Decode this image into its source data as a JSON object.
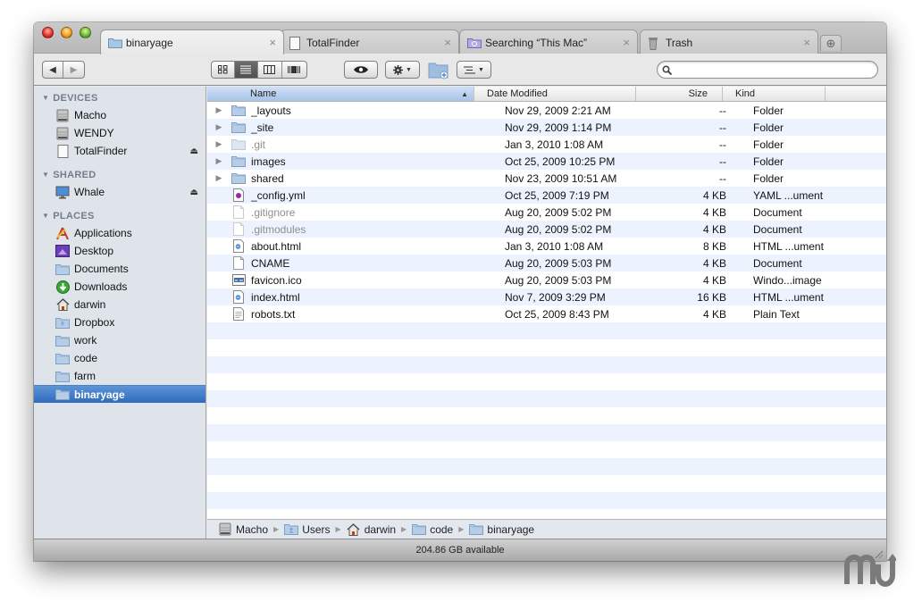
{
  "window": {
    "tabs": [
      {
        "label": "binaryage",
        "icon": "folder-icon",
        "active": true
      },
      {
        "label": "TotalFinder",
        "icon": "drive-icon",
        "active": false
      },
      {
        "label": "Searching “This Mac”",
        "icon": "smart-folder-icon",
        "active": false
      },
      {
        "label": "Trash",
        "icon": "trash-icon",
        "active": false
      }
    ],
    "tab_close_glyph": "×",
    "new_tab_glyph": "⊕"
  },
  "toolbar": {
    "back_glyph": "◀",
    "forward_glyph": "▶",
    "view_modes": [
      "icon",
      "list",
      "column",
      "coverflow"
    ],
    "active_view": "list",
    "search_placeholder": "",
    "search_value": ""
  },
  "sidebar": {
    "sections": [
      {
        "title": "DEVICES",
        "items": [
          {
            "label": "Macho",
            "icon": "hard-drive-icon",
            "eject": false
          },
          {
            "label": "WENDY",
            "icon": "hard-drive-icon",
            "eject": false
          },
          {
            "label": "TotalFinder",
            "icon": "disk-image-icon",
            "eject": true
          }
        ]
      },
      {
        "title": "SHARED",
        "items": [
          {
            "label": "Whale",
            "icon": "network-computer-icon",
            "eject": true
          }
        ]
      },
      {
        "title": "PLACES",
        "items": [
          {
            "label": "Applications",
            "icon": "applications-icon",
            "eject": false
          },
          {
            "label": "Desktop",
            "icon": "desktop-icon",
            "eject": false
          },
          {
            "label": "Documents",
            "icon": "folder-icon",
            "eject": false
          },
          {
            "label": "Downloads",
            "icon": "downloads-icon",
            "eject": false
          },
          {
            "label": "darwin",
            "icon": "home-icon",
            "eject": false
          },
          {
            "label": "Dropbox",
            "icon": "dropbox-folder-icon",
            "eject": false
          },
          {
            "label": "work",
            "icon": "folder-icon",
            "eject": false
          },
          {
            "label": "code",
            "icon": "folder-icon",
            "eject": false
          },
          {
            "label": "farm",
            "icon": "folder-icon",
            "eject": false
          },
          {
            "label": "binaryage",
            "icon": "folder-icon",
            "eject": false,
            "selected": true
          }
        ]
      }
    ],
    "eject_glyph": "⏏",
    "disclosure_glyph": "▼"
  },
  "list": {
    "columns": {
      "name": "Name",
      "date": "Date Modified",
      "size": "Size",
      "kind": "Kind"
    },
    "sort_glyph": "▲",
    "rows": [
      {
        "name": "_layouts",
        "date": "Nov 29, 2009 2:21 AM",
        "size": "--",
        "kind": "Folder",
        "type": "folder",
        "expandable": true,
        "dim": false
      },
      {
        "name": "_site",
        "date": "Nov 29, 2009 1:14 PM",
        "size": "--",
        "kind": "Folder",
        "type": "folder",
        "expandable": true,
        "dim": false
      },
      {
        "name": ".git",
        "date": "Jan 3, 2010 1:08 AM",
        "size": "--",
        "kind": "Folder",
        "type": "folder",
        "expandable": true,
        "dim": true
      },
      {
        "name": "images",
        "date": "Oct 25, 2009 10:25 PM",
        "size": "--",
        "kind": "Folder",
        "type": "folder",
        "expandable": true,
        "dim": false
      },
      {
        "name": "shared",
        "date": "Nov 23, 2009 10:51 AM",
        "size": "--",
        "kind": "Folder",
        "type": "folder",
        "expandable": true,
        "dim": false
      },
      {
        "name": "_config.yml",
        "date": "Oct 25, 2009 7:19 PM",
        "size": "4 KB",
        "kind": "YAML ...ument",
        "type": "yaml",
        "expandable": false,
        "dim": false
      },
      {
        "name": ".gitignore",
        "date": "Aug 20, 2009 5:02 PM",
        "size": "4 KB",
        "kind": "Document",
        "type": "doc",
        "expandable": false,
        "dim": true
      },
      {
        "name": ".gitmodules",
        "date": "Aug 20, 2009 5:02 PM",
        "size": "4 KB",
        "kind": "Document",
        "type": "doc",
        "expandable": false,
        "dim": true
      },
      {
        "name": "about.html",
        "date": "Jan 3, 2010 1:08 AM",
        "size": "8 KB",
        "kind": "HTML ...ument",
        "type": "html",
        "expandable": false,
        "dim": false
      },
      {
        "name": "CNAME",
        "date": "Aug 20, 2009 5:03 PM",
        "size": "4 KB",
        "kind": "Document",
        "type": "doc",
        "expandable": false,
        "dim": false
      },
      {
        "name": "favicon.ico",
        "date": "Aug 20, 2009 5:03 PM",
        "size": "4 KB",
        "kind": "Windo...image",
        "type": "image",
        "expandable": false,
        "dim": false
      },
      {
        "name": "index.html",
        "date": "Nov 7, 2009 3:29 PM",
        "size": "16 KB",
        "kind": "HTML ...ument",
        "type": "html",
        "expandable": false,
        "dim": false
      },
      {
        "name": "robots.txt",
        "date": "Oct 25, 2009 8:43 PM",
        "size": "4 KB",
        "kind": "Plain Text",
        "type": "text",
        "expandable": false,
        "dim": false
      }
    ],
    "disclosure_glyph": "▶"
  },
  "pathbar": {
    "crumbs": [
      {
        "label": "Macho",
        "icon": "hard-drive-icon"
      },
      {
        "label": "Users",
        "icon": "users-folder-icon"
      },
      {
        "label": "darwin",
        "icon": "home-icon"
      },
      {
        "label": "code",
        "icon": "folder-icon"
      },
      {
        "label": "binaryage",
        "icon": "folder-icon"
      }
    ],
    "separator_glyph": "▶"
  },
  "status": {
    "text": "204.86 GB available"
  },
  "colors": {
    "selection": "#3a74c5",
    "row_alt": "#edf3fe",
    "sidebar_bg": "#dfe4eb",
    "sidebar_header": "#737d8a"
  }
}
